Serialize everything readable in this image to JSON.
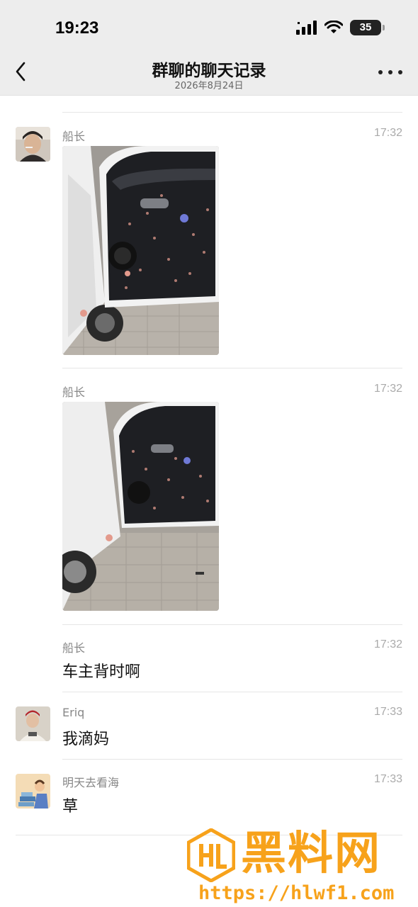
{
  "status_bar": {
    "time": "19:23",
    "battery": "35"
  },
  "header": {
    "title": "群聊的聊天记录",
    "date": "2026年8月24日"
  },
  "messages": [
    {
      "sender": "船长",
      "time": "17:32",
      "type": "image"
    },
    {
      "sender": "船长",
      "time": "17:32",
      "type": "image"
    },
    {
      "sender": "船长",
      "time": "17:32",
      "type": "text",
      "text": "车主背时啊"
    },
    {
      "sender": "Eriq",
      "time": "17:33",
      "type": "text",
      "text": "我滴妈"
    },
    {
      "sender": "明天去看海",
      "time": "17:33",
      "type": "text",
      "text": "草"
    }
  ],
  "watermark": {
    "title": "黑料网",
    "url": "https://hlwf1.com"
  },
  "icons": {
    "back": "chevron-left-icon",
    "more": "more-icon",
    "signal": "signal-icon",
    "wifi": "wifi-icon",
    "battery": "battery-icon"
  }
}
